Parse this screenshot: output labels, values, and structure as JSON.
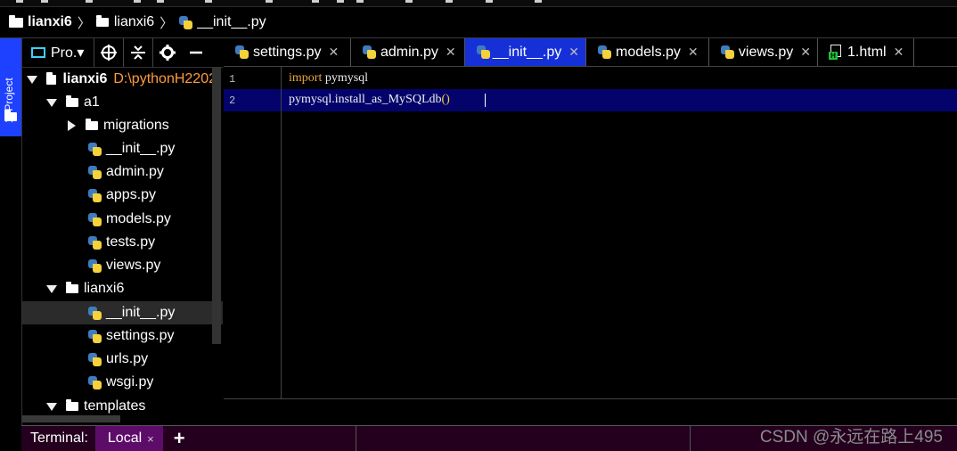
{
  "breadcrumb": [
    {
      "label": "lianxi6",
      "icon": "folder-icon",
      "bold": true
    },
    {
      "label": "lianxi6",
      "icon": "folder-icon",
      "bold": false
    },
    {
      "label": "__init__.py",
      "icon": "python-file-icon",
      "bold": false
    }
  ],
  "sidebar": {
    "project_tab_label": "1: Project"
  },
  "project_toolbar": {
    "view_label": "Pro.▾",
    "icons": [
      "locate-icon",
      "collapse-icon",
      "gear-icon",
      "minimize-icon"
    ]
  },
  "tree": {
    "root_label": "lianxi6",
    "root_path": "D:\\pythonH2202",
    "a1_label": "a1",
    "migrations_label": "migrations",
    "a1_files": [
      "__init__.py",
      "admin.py",
      "apps.py",
      "models.py",
      "tests.py",
      "views.py"
    ],
    "pkg_label": "lianxi6",
    "pkg_files": [
      "__init__.py",
      "settings.py",
      "urls.py",
      "wsgi.py"
    ],
    "templates_label": "templates"
  },
  "tabs": [
    {
      "label": "settings.py",
      "icon": "python-file-icon",
      "active": false
    },
    {
      "label": "admin.py",
      "icon": "python-file-icon",
      "active": false
    },
    {
      "label": "__init__.py",
      "icon": "python-file-icon",
      "active": true
    },
    {
      "label": "models.py",
      "icon": "python-file-icon",
      "active": false
    },
    {
      "label": "views.py",
      "icon": "python-file-icon",
      "active": false
    },
    {
      "label": "1.html",
      "icon": "html-file-icon",
      "active": false
    }
  ],
  "editor": {
    "line_numbers": [
      "1",
      "2"
    ],
    "line1_keyword": "import",
    "line1_rest": " pymysql",
    "line2_code": "pymysql.install_as_MySQLdb",
    "line2_parens": "()"
  },
  "terminal": {
    "label": "Terminal:",
    "tab_label": "Local",
    "close": "×",
    "add": "+"
  },
  "watermark": "CSDN @永远在路上495",
  "colors": {
    "accent": "#1630d8",
    "current_line": "#03036b",
    "keyword": "#e7a53b",
    "path": "#ff9b3d",
    "terminal_bg": "#24001e",
    "terminal_tab": "#5e0c6a"
  }
}
